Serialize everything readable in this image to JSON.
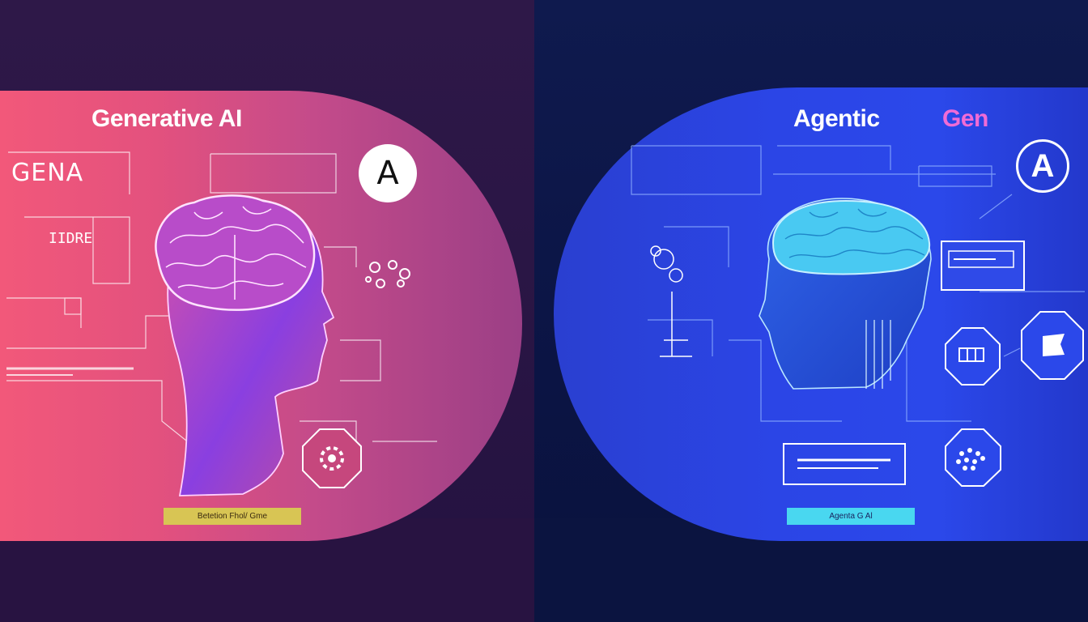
{
  "left": {
    "title": "Generative AI",
    "gena_text": "GENA",
    "box_text": "IIDRE",
    "badge_letter": "A",
    "caption": "Betetion Fhol/ Gme"
  },
  "right": {
    "title_part1": "Agentic",
    "title_part2": "Gen",
    "badge_letter": "A",
    "caption": "Agenta G Al"
  },
  "colors": {
    "left_panel": "#e3517e",
    "right_panel": "#2b45e6",
    "gen_accent": "#f06bd6",
    "left_caption_bg": "#d8c554",
    "right_caption_bg": "#49d7f0"
  },
  "icons": [
    "brain-icon",
    "head-profile-icon",
    "gear-icon",
    "circuit-icon",
    "grid-icon",
    "flag-icon",
    "dots-icon"
  ]
}
